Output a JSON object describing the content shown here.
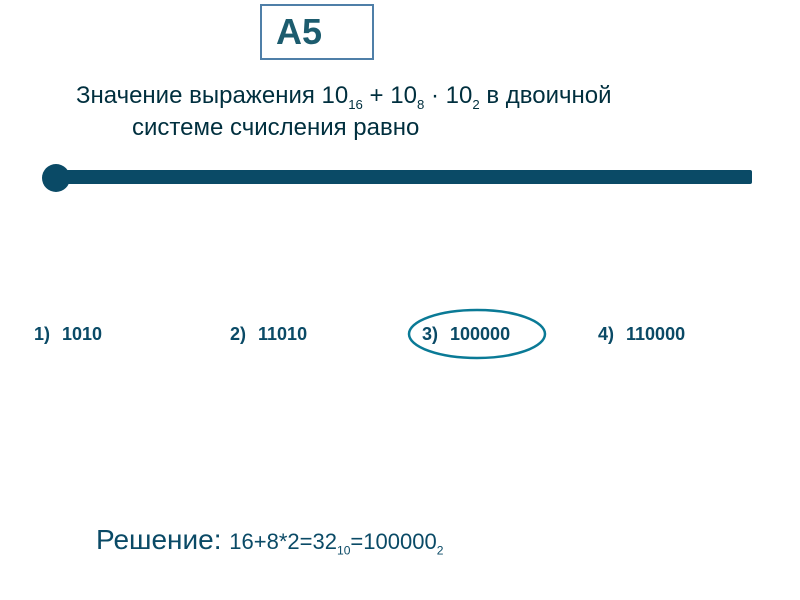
{
  "badge": {
    "label": "A5"
  },
  "question": {
    "prefix": "Значение выражения 10",
    "sub1": "16",
    "mid1": " + 10",
    "sub2": "8",
    "mid2": " · 10",
    "sub3": "2",
    "suffix": " в двоичной",
    "line2": "системе счисления равно"
  },
  "options": [
    {
      "n": "1)",
      "v": "1010"
    },
    {
      "n": "2)",
      "v": "11010"
    },
    {
      "n": "3)",
      "v": "100000"
    },
    {
      "n": "4)",
      "v": "110000"
    }
  ],
  "correct_index": 2,
  "solution": {
    "lead": "Решение: ",
    "expr_a": "16+8*2=32",
    "sub_a": "10",
    "eq": "=100000",
    "sub_b": "2"
  },
  "colors": {
    "accent": "#0a4a66",
    "badge_border": "#4f7fa8",
    "text": "#002f3e"
  }
}
